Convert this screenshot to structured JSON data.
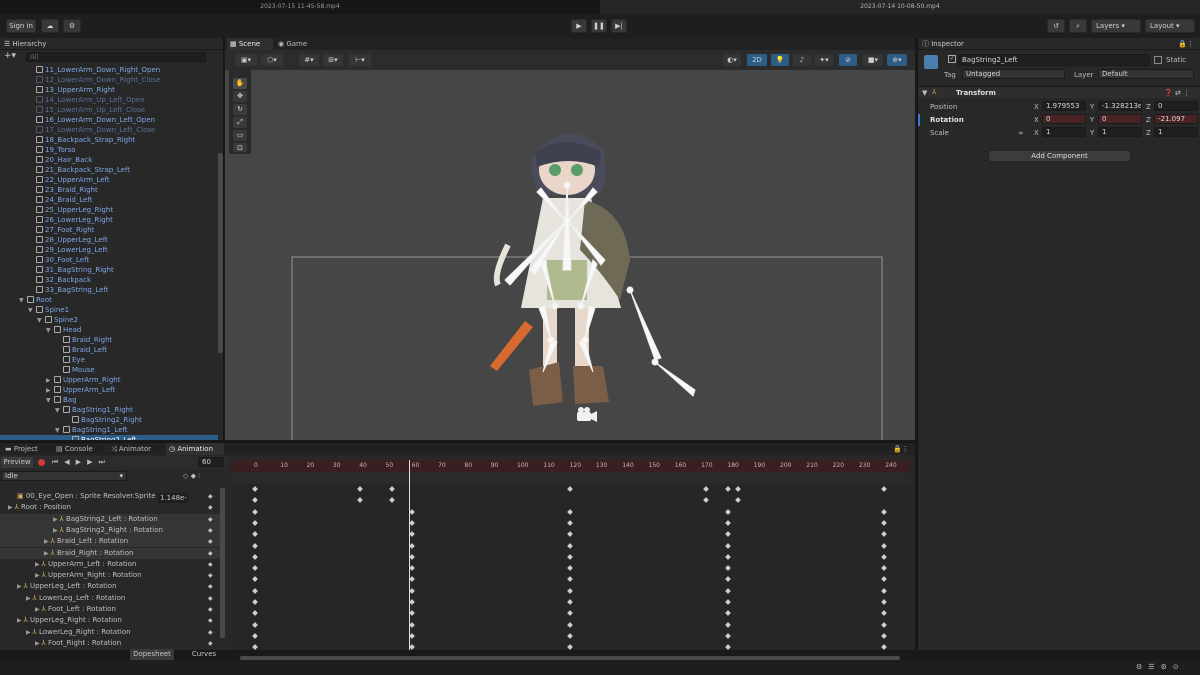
{
  "window_tabs": [
    "2023-07-15 11-45-58.mp4",
    "2023-07-14 10-08-50.mp4"
  ],
  "toolbar": {
    "sign_in": "Sign in",
    "layers": "Layers",
    "layout": "Layout"
  },
  "hierarchy": {
    "title": "Hierarchy",
    "search_placeholder": "All",
    "items": [
      {
        "label": "11_LowerArm_Down_Right_Open",
        "style": "prefab",
        "indent": 0
      },
      {
        "label": "12_LowerArm_Down_Right_Close",
        "style": "dim",
        "indent": 0
      },
      {
        "label": "13_UpperArm_Right",
        "style": "prefab",
        "indent": 0
      },
      {
        "label": "14_LowerArm_Up_Left_Open",
        "style": "dim",
        "indent": 0
      },
      {
        "label": "15_LowerArm_Up_Left_Close",
        "style": "dim",
        "indent": 0
      },
      {
        "label": "16_LowerArm_Down_Left_Open",
        "style": "prefab",
        "indent": 0
      },
      {
        "label": "17_LowerArm_Down_Left_Close",
        "style": "dim",
        "indent": 0
      },
      {
        "label": "18_Backpack_Strap_Right",
        "style": "prefab",
        "indent": 0
      },
      {
        "label": "19_Torso",
        "style": "prefab",
        "indent": 0
      },
      {
        "label": "20_Hair_Back",
        "style": "prefab",
        "indent": 0
      },
      {
        "label": "21_Backpack_Strap_Left",
        "style": "prefab",
        "indent": 0
      },
      {
        "label": "22_UpperArm_Left",
        "style": "prefab",
        "indent": 0
      },
      {
        "label": "23_Braid_Right",
        "style": "prefab",
        "indent": 0
      },
      {
        "label": "24_Braid_Left",
        "style": "prefab",
        "indent": 0
      },
      {
        "label": "25_UpperLeg_Right",
        "style": "prefab",
        "indent": 0
      },
      {
        "label": "26_LowerLeg_Right",
        "style": "prefab",
        "indent": 0
      },
      {
        "label": "27_Foot_Right",
        "style": "prefab",
        "indent": 0
      },
      {
        "label": "28_UpperLeg_Left",
        "style": "prefab",
        "indent": 0
      },
      {
        "label": "29_LowerLeg_Left",
        "style": "prefab",
        "indent": 0
      },
      {
        "label": "30_Foot_Left",
        "style": "prefab",
        "indent": 0
      },
      {
        "label": "31_BagString_Right",
        "style": "prefab",
        "indent": 0
      },
      {
        "label": "32_Backpack",
        "style": "prefab",
        "indent": 0
      },
      {
        "label": "33_BagString_Left",
        "style": "prefab",
        "indent": 0
      },
      {
        "label": "Root",
        "style": "prefab",
        "indent": -1,
        "arrow": "▼"
      },
      {
        "label": "Spine1",
        "style": "prefab",
        "indent": 0,
        "arrow": "▼"
      },
      {
        "label": "Spine2",
        "style": "prefab",
        "indent": 1,
        "arrow": "▼"
      },
      {
        "label": "Head",
        "style": "prefab",
        "indent": 2,
        "arrow": "▼"
      },
      {
        "label": "Braid_Right",
        "style": "prefab",
        "indent": 3
      },
      {
        "label": "Braid_Left",
        "style": "prefab",
        "indent": 3
      },
      {
        "label": "Eye",
        "style": "prefab",
        "indent": 3
      },
      {
        "label": "Mouse",
        "style": "prefab",
        "indent": 3
      },
      {
        "label": "UpperArm_Right",
        "style": "prefab",
        "indent": 2,
        "arrow": "▶"
      },
      {
        "label": "UpperArm_Left",
        "style": "prefab",
        "indent": 2,
        "arrow": "▶"
      },
      {
        "label": "Bag",
        "style": "prefab",
        "indent": 2,
        "arrow": "▼"
      },
      {
        "label": "BagString1_Right",
        "style": "prefab",
        "indent": 3,
        "arrow": "▼"
      },
      {
        "label": "BagString2_Right",
        "style": "prefab",
        "indent": 4
      },
      {
        "label": "BagString1_Left",
        "style": "prefab",
        "indent": 3,
        "arrow": "▼"
      },
      {
        "label": "BagString2_Left",
        "style": "selected",
        "indent": 4
      }
    ]
  },
  "scene": {
    "tab_scene": "Scene",
    "tab_game": "Game",
    "mode_2d": "2D"
  },
  "inspector": {
    "title": "Inspector",
    "object_name": "BagString2_Left",
    "static_label": "Static",
    "tag_label": "Tag",
    "tag_value": "Untagged",
    "layer_label": "Layer",
    "layer_value": "Default",
    "component": "Transform",
    "position_label": "Position",
    "rotation_label": "Rotation",
    "scale_label": "Scale",
    "position": {
      "x": "1.979553",
      "y": "-1.328213e",
      "z": "0"
    },
    "rotation": {
      "x": "0",
      "y": "0",
      "z": "-21.097"
    },
    "scale": {
      "x": "1",
      "y": "1",
      "z": "1"
    },
    "add_component": "Add Component"
  },
  "bottom_tabs": [
    "Project",
    "Console",
    "Animator",
    "Animation"
  ],
  "animation": {
    "preview": "Preview",
    "frame": "60",
    "clip": "Idle",
    "ruler": [
      "0",
      "10",
      "20",
      "30",
      "40",
      "50",
      "60",
      "70",
      "80",
      "90",
      "100",
      "110",
      "120",
      "130",
      "140",
      "150",
      "160",
      "170",
      "180",
      "190",
      "200",
      "210",
      "220",
      "230",
      "240"
    ],
    "sprite_value": "1.148e-",
    "properties": [
      {
        "label": "00_Eye_Open : Sprite Resolver.Sprite",
        "indent": 1
      },
      {
        "label": "Root : Position",
        "indent": 0,
        "arrow": "▶"
      },
      {
        "label": "BagString2_Left : Rotation",
        "indent": 5,
        "arrow": "▶"
      },
      {
        "label": "BagString2_Right : Rotation",
        "indent": 5,
        "arrow": "▶"
      },
      {
        "label": "Braid_Left : Rotation",
        "indent": 4,
        "arrow": "▶"
      },
      {
        "label": "Braid_Right : Rotation",
        "indent": 4,
        "arrow": "▶"
      },
      {
        "label": "UpperArm_Left : Rotation",
        "indent": 3,
        "arrow": "▶"
      },
      {
        "label": "UpperArm_Right : Rotation",
        "indent": 3,
        "arrow": "▶"
      },
      {
        "label": "UpperLeg_Left : Rotation",
        "indent": 1,
        "arrow": "▶"
      },
      {
        "label": "LowerLeg_Left : Rotation",
        "indent": 2,
        "arrow": "▶"
      },
      {
        "label": "Foot_Left : Rotation",
        "indent": 3,
        "arrow": "▶"
      },
      {
        "label": "UpperLeg_Right : Rotation",
        "indent": 1,
        "arrow": "▶"
      },
      {
        "label": "LowerLeg_Right : Rotation",
        "indent": 2,
        "arrow": "▶"
      },
      {
        "label": "Foot_Right : Rotation",
        "indent": 3,
        "arrow": "▶"
      }
    ],
    "dopesheet": "Dopesheet",
    "curves": "Curves"
  },
  "colors": {
    "accent": "#2c5d87",
    "record": "#d23a3a",
    "timeline": "#3a1f22"
  }
}
